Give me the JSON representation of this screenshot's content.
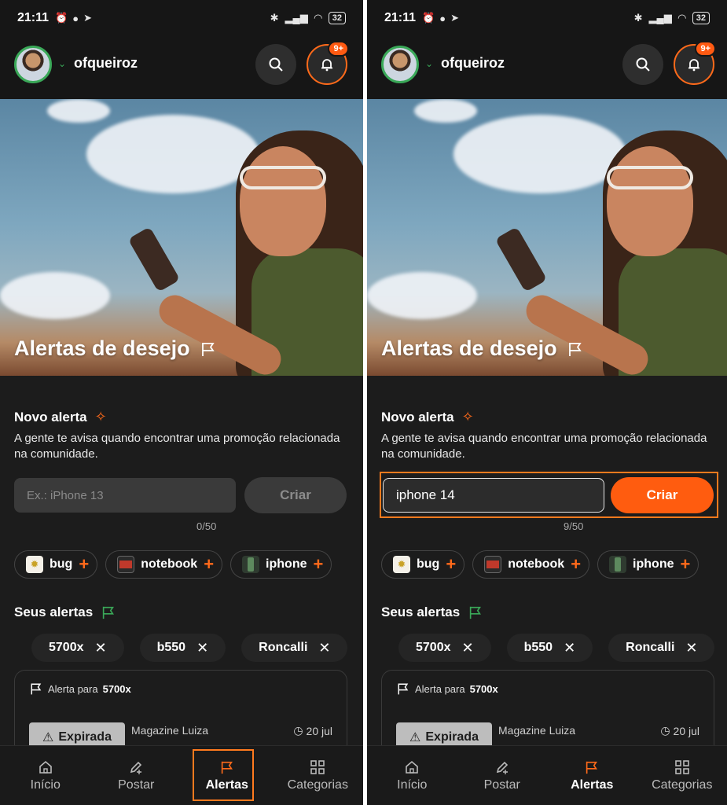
{
  "status": {
    "time": "21:11",
    "battery": "32"
  },
  "header": {
    "username": "ofqueiroz",
    "badge": "9+"
  },
  "hero": {
    "title": "Alertas de desejo"
  },
  "novo_alerta": {
    "title": "Novo alerta",
    "description": "A gente te avisa quando encontrar uma promoção relacionada na comunidade.",
    "left": {
      "placeholder": "Ex.: iPhone 13",
      "counter": "0/50",
      "button": "Criar"
    },
    "right": {
      "value": "iphone 14",
      "counter": "9/50",
      "button": "Criar"
    }
  },
  "suggestions": [
    {
      "label": "bug"
    },
    {
      "label": "notebook"
    },
    {
      "label": "iphone"
    }
  ],
  "seus_alertas": {
    "title": "Seus alertas",
    "tags": [
      "5700x",
      "b550",
      "Roncalli"
    ]
  },
  "alert_card": {
    "prefix": "Alerta para",
    "keyword": "5700x",
    "status": "Expirada",
    "store": "Magazine Luiza",
    "date": "20 jul"
  },
  "nav": [
    {
      "label": "Início",
      "icon": "home-icon"
    },
    {
      "label": "Postar",
      "icon": "pencil-plus-icon"
    },
    {
      "label": "Alertas",
      "icon": "flag-icon"
    },
    {
      "label": "Categorias",
      "icon": "grid-icon"
    }
  ],
  "colors": {
    "accent": "#ff5c0f",
    "green": "#3aa858",
    "background": "#1c1c1c"
  }
}
